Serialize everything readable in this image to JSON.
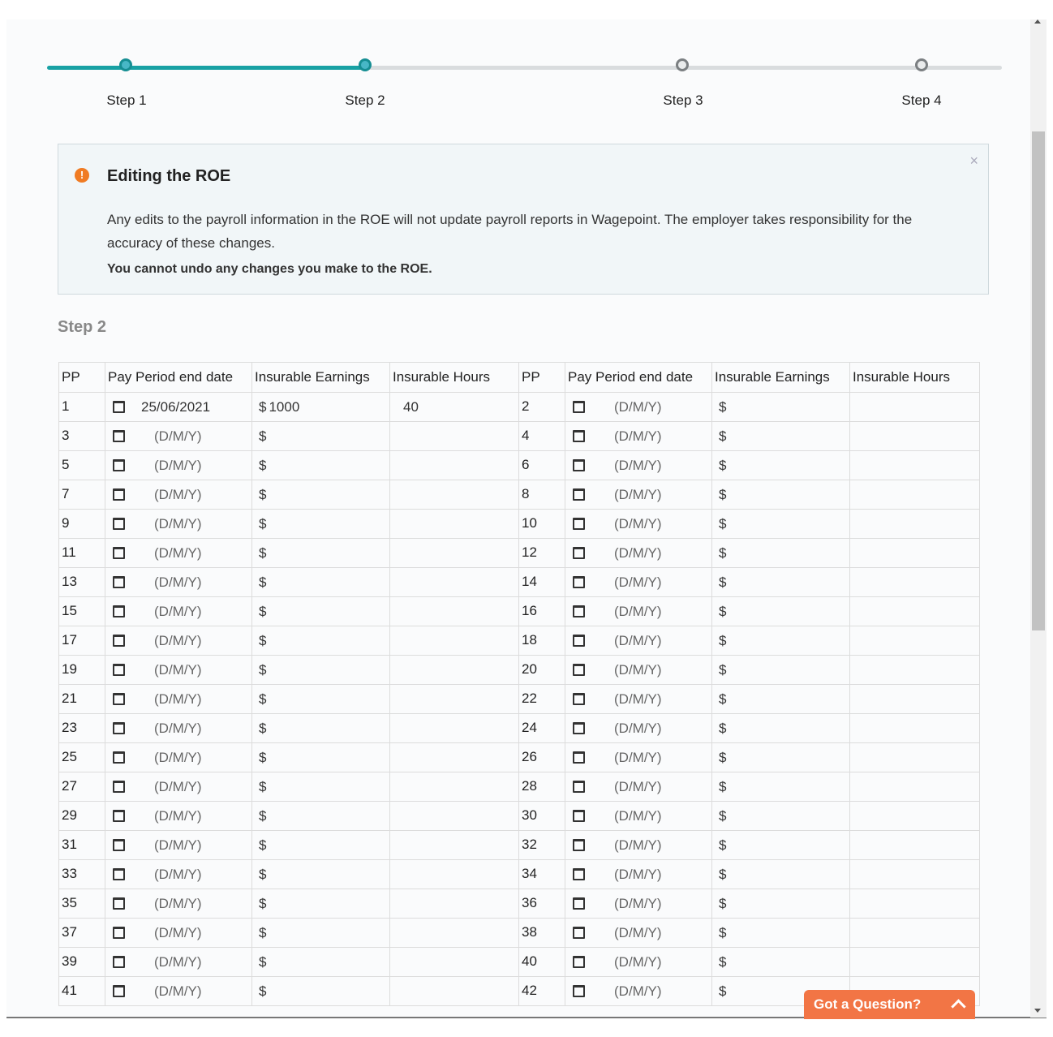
{
  "stepper": {
    "steps": [
      {
        "label": "Step 1",
        "state": "done"
      },
      {
        "label": "Step 2",
        "state": "done"
      },
      {
        "label": "Step 3",
        "state": "todo"
      },
      {
        "label": "Step 4",
        "state": "todo"
      }
    ],
    "colors": {
      "done": "#18a1a4",
      "todo": "#d9dcde"
    }
  },
  "alert": {
    "icon": "info-icon",
    "title": "Editing the ROE",
    "body": "Any edits to the payroll information in the ROE will not update payroll reports in Wagepoint. The employer takes responsibility for the accuracy of these changes.",
    "note": "You cannot undo any changes you make to the ROE.",
    "close_label": "×"
  },
  "section_title": "Step 2",
  "table": {
    "headers": [
      "PP",
      "Pay Period end date",
      "Insurable Earnings",
      "Insurable Hours",
      "PP",
      "Pay Period end date",
      "Insurable Earnings",
      "Insurable Hours"
    ],
    "date_placeholder": "(D/M/Y)",
    "currency_symbol": "$",
    "rows": [
      {
        "pp": "1",
        "date": "25/06/2021",
        "earnings": "1000",
        "hours": "40"
      },
      {
        "pp": "2",
        "date": "",
        "earnings": "",
        "hours": ""
      },
      {
        "pp": "3"
      },
      {
        "pp": "4"
      },
      {
        "pp": "5"
      },
      {
        "pp": "6"
      },
      {
        "pp": "7"
      },
      {
        "pp": "8"
      },
      {
        "pp": "9"
      },
      {
        "pp": "10"
      },
      {
        "pp": "11"
      },
      {
        "pp": "12"
      },
      {
        "pp": "13"
      },
      {
        "pp": "14"
      },
      {
        "pp": "15"
      },
      {
        "pp": "16"
      },
      {
        "pp": "17"
      },
      {
        "pp": "18"
      },
      {
        "pp": "19"
      },
      {
        "pp": "20"
      },
      {
        "pp": "21"
      },
      {
        "pp": "22"
      },
      {
        "pp": "23"
      },
      {
        "pp": "24"
      },
      {
        "pp": "25"
      },
      {
        "pp": "26"
      },
      {
        "pp": "27"
      },
      {
        "pp": "28"
      },
      {
        "pp": "29"
      },
      {
        "pp": "30"
      },
      {
        "pp": "31"
      },
      {
        "pp": "32"
      },
      {
        "pp": "33"
      },
      {
        "pp": "34"
      },
      {
        "pp": "35"
      },
      {
        "pp": "36"
      },
      {
        "pp": "37"
      },
      {
        "pp": "38"
      },
      {
        "pp": "39"
      },
      {
        "pp": "40"
      },
      {
        "pp": "41"
      },
      {
        "pp": "42"
      }
    ]
  },
  "help_button": {
    "label": "Got a Question?",
    "color": "#f27545"
  }
}
